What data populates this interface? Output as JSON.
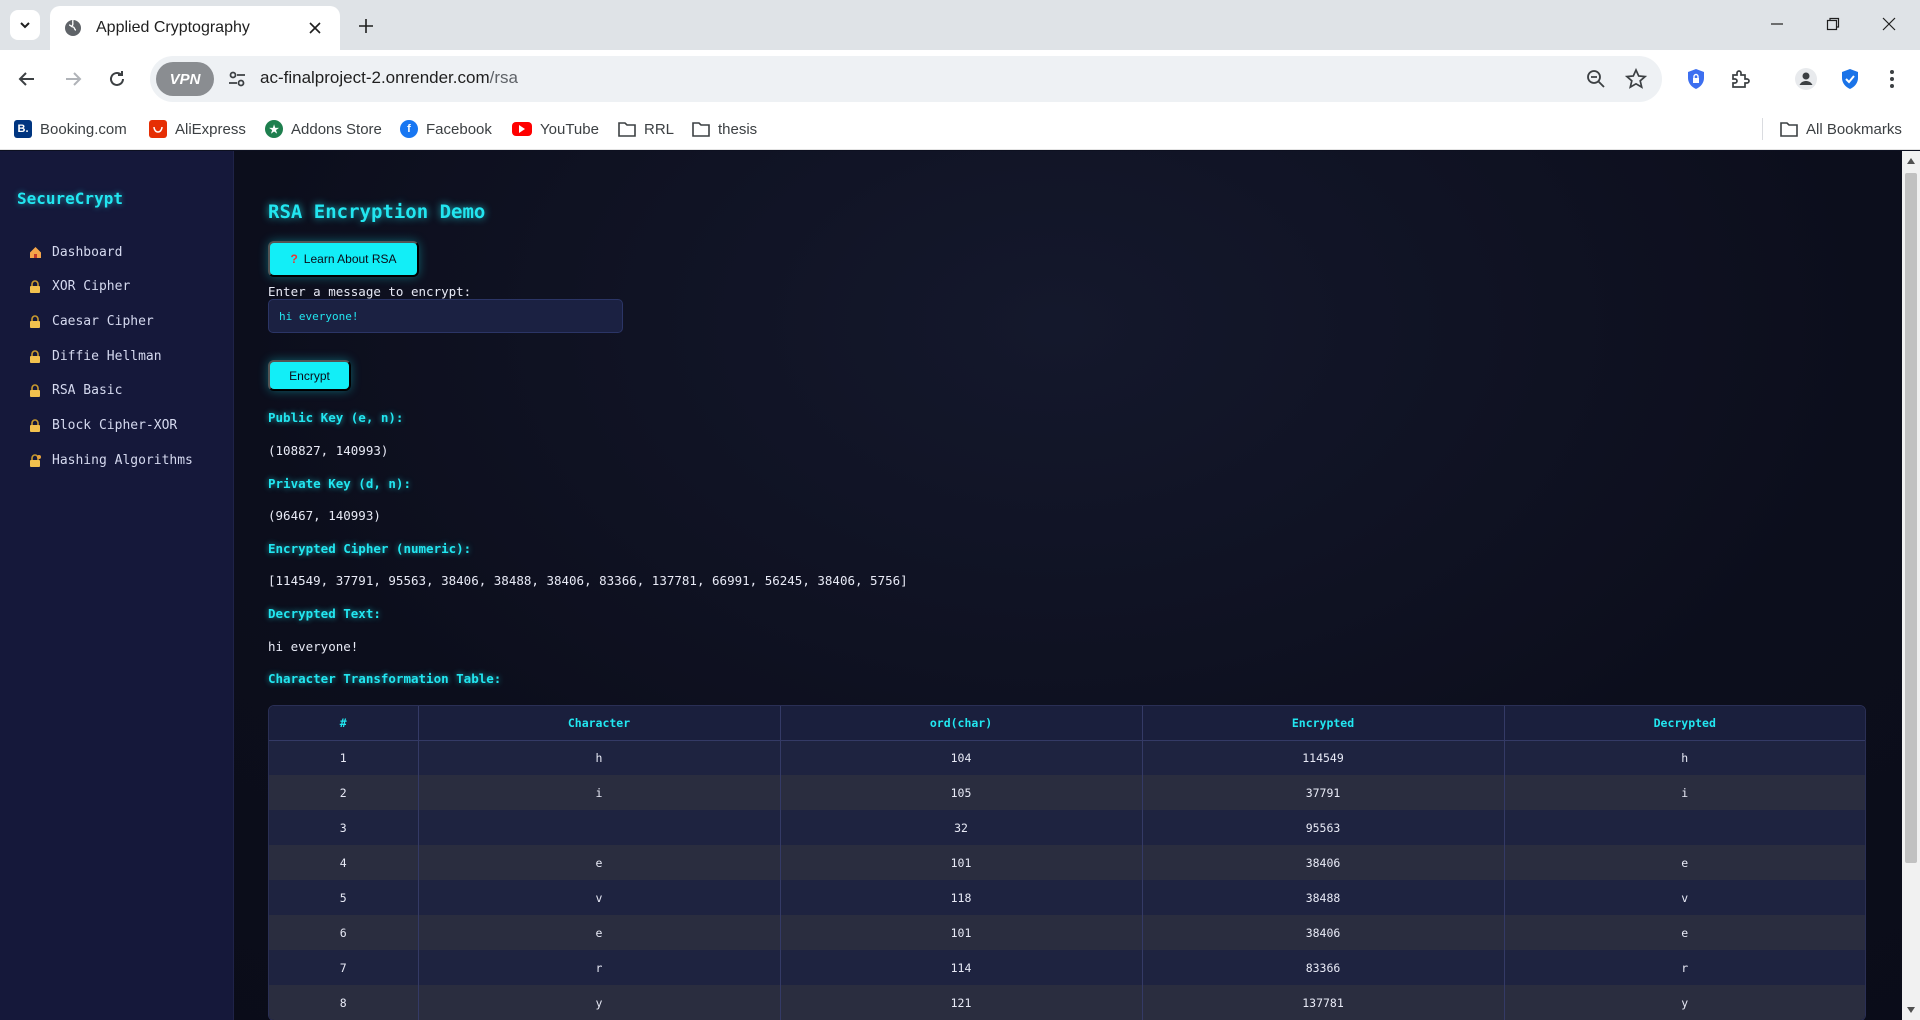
{
  "browser": {
    "tab_title": "Applied Cryptography",
    "url_host": "ac-finalproject-2.onrender.com",
    "url_path": "/rsa",
    "vpn_label": "VPN",
    "bookmarks": [
      {
        "label": "Booking.com",
        "icon": "booking-icon",
        "color": "#003580"
      },
      {
        "label": "AliExpress",
        "icon": "aliexpress-icon",
        "color": "#e62e04"
      },
      {
        "label": "Addons Store",
        "icon": "addons-store-icon",
        "color": "#1e7f4e"
      },
      {
        "label": "Facebook",
        "icon": "facebook-icon",
        "color": "#1877f2"
      },
      {
        "label": "YouTube",
        "icon": "youtube-icon",
        "color": "#ff0000"
      },
      {
        "label": "RRL",
        "icon": "folder-icon"
      },
      {
        "label": "thesis",
        "icon": "folder-icon"
      }
    ],
    "all_bookmarks": "All Bookmarks"
  },
  "sidebar": {
    "brand": "SecureCrypt",
    "items": [
      {
        "label": "Dashboard",
        "icon": "home-icon"
      },
      {
        "label": "XOR Cipher",
        "icon": "lock-icon"
      },
      {
        "label": "Caesar Cipher",
        "icon": "lock-icon"
      },
      {
        "label": "Diffie Hellman",
        "icon": "lock-icon"
      },
      {
        "label": "RSA Basic",
        "icon": "lock-icon"
      },
      {
        "label": "Block Cipher-XOR",
        "icon": "lock-icon"
      },
      {
        "label": "Hashing Algorithms",
        "icon": "lock-key-icon"
      }
    ]
  },
  "main": {
    "title": "RSA Encryption Demo",
    "learn_button": "Learn About RSA",
    "learn_button_icon": "question-icon",
    "input_label": "Enter a message to encrypt:",
    "input_value": "hi everyone!",
    "encrypt_button": "Encrypt",
    "public_key_label": "Public Key (e, n):",
    "public_key_value": "(108827, 140993)",
    "private_key_label": "Private Key (d, n):",
    "private_key_value": "(96467, 140993)",
    "cipher_label": "Encrypted Cipher (numeric):",
    "cipher_value": "[114549, 37791, 95563, 38406, 38488, 38406, 83366, 137781, 66991, 56245, 38406, 5756]",
    "decrypted_label": "Decrypted Text:",
    "decrypted_value": "hi everyone!",
    "table_label": "Character Transformation Table:"
  },
  "table": {
    "headers": [
      "#",
      "Character",
      "ord(char)",
      "Encrypted",
      "Decrypted"
    ],
    "rows": [
      [
        "1",
        "h",
        "104",
        "114549",
        "h"
      ],
      [
        "2",
        "i",
        "105",
        "37791",
        "i"
      ],
      [
        "3",
        "",
        "32",
        "95563",
        ""
      ],
      [
        "4",
        "e",
        "101",
        "38406",
        "e"
      ],
      [
        "5",
        "v",
        "118",
        "38488",
        "v"
      ],
      [
        "6",
        "e",
        "101",
        "38406",
        "e"
      ],
      [
        "7",
        "r",
        "114",
        "83366",
        "r"
      ],
      [
        "8",
        "y",
        "121",
        "137781",
        "y"
      ]
    ]
  },
  "colors": {
    "accent": "#22e6f0",
    "sidebar_bg": "#15183a",
    "page_bg": "#0c0e1c"
  }
}
